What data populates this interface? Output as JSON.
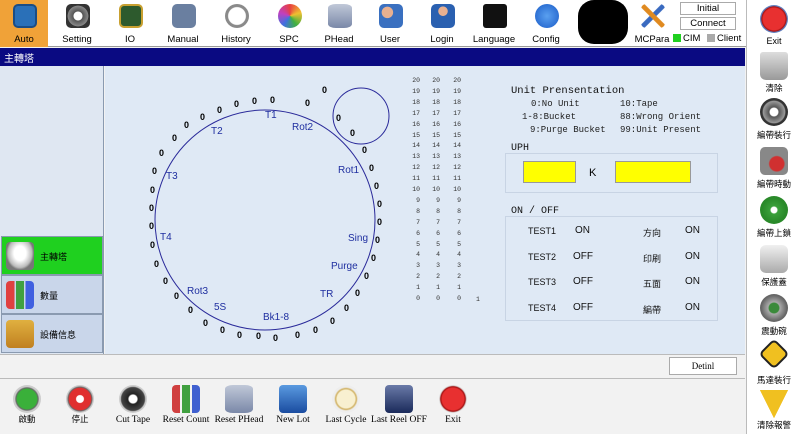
{
  "toolbar": {
    "items": [
      {
        "label": "Auto",
        "icon": "monitor-icon"
      },
      {
        "label": "Setting",
        "icon": "gear-icon"
      },
      {
        "label": "IO",
        "icon": "circuit-board-icon"
      },
      {
        "label": "Manual",
        "icon": "hand-tool-icon"
      },
      {
        "label": "History",
        "icon": "clock-icon"
      },
      {
        "label": "SPC",
        "icon": "cycle-icon"
      },
      {
        "label": "PHead",
        "icon": "database-icon"
      },
      {
        "label": "User",
        "icon": "users-icon"
      },
      {
        "label": "Login",
        "icon": "user-login-icon"
      },
      {
        "label": "Language",
        "icon": "language-icon"
      },
      {
        "label": "Config",
        "icon": "app-store-icon"
      }
    ],
    "mcpara_label": "MCPara",
    "initial_label": "Initial",
    "connect_label": "Connect",
    "cim_label": "CIM",
    "client_label": "Client",
    "exit_label": "Exit"
  },
  "title": "主轉塔",
  "left_menu": [
    {
      "label": "主轉塔",
      "icon": "turret-icon",
      "active": true
    },
    {
      "label": "數量",
      "icon": "bar-chart-icon",
      "active": false
    },
    {
      "label": "設備信息",
      "icon": "equipment-info-icon",
      "active": false
    }
  ],
  "turret": {
    "zero": "0",
    "stations": [
      "T1",
      "Rot2",
      "Rot1",
      "Sing",
      "Purge",
      "TR",
      "Bk1-8",
      "5S",
      "Rot3",
      "T4",
      "T3",
      "T2"
    ]
  },
  "columns": {
    "col1": [
      "20",
      "19",
      "18",
      "17",
      "16",
      "15",
      "14",
      "13",
      "12",
      "11",
      "10",
      "9",
      "8",
      "7",
      "6",
      "5",
      "4",
      "3",
      "2",
      "1",
      "0"
    ],
    "col2": [
      "20",
      "19",
      "18",
      "17",
      "16",
      "15",
      "14",
      "13",
      "12",
      "11",
      "10",
      "9",
      "8",
      "7",
      "6",
      "5",
      "4",
      "3",
      "2",
      "1",
      "0"
    ],
    "col3": [
      "20",
      "19",
      "18",
      "17",
      "16",
      "15",
      "14",
      "13",
      "12",
      "11",
      "10",
      "9",
      "8",
      "7",
      "6",
      "5",
      "4",
      "3",
      "2",
      "1",
      "0"
    ],
    "extra": "1"
  },
  "unit_presentation": {
    "title": "Unit Prensentation",
    "left": [
      "0:No Unit",
      "1-8:Bucket",
      "9:Purge Bucket"
    ],
    "right": [
      "10:Tape",
      "88:Wrong Orient",
      "99:Unit Present"
    ]
  },
  "uph": {
    "title": "UPH",
    "unit": "K"
  },
  "onoff": {
    "title": "ON / OFF",
    "rows": [
      {
        "name": "TEST1",
        "value": "ON",
        "name2": "方向",
        "value2": "ON"
      },
      {
        "name": "TEST2",
        "value": "OFF",
        "name2": "印刷",
        "value2": "ON"
      },
      {
        "name": "TEST3",
        "value": "OFF",
        "name2": "五面",
        "value2": "ON"
      },
      {
        "name": "TEST4",
        "value": "OFF",
        "name2": "編帶",
        "value2": "ON"
      }
    ]
  },
  "right_menu": [
    {
      "label": "清除",
      "icon": "trash-icon"
    },
    {
      "label": "編帶裝行",
      "icon": "tape-reel-icon"
    },
    {
      "label": "編帶時動",
      "icon": "tape-gear-icon"
    },
    {
      "label": "編帶上鎖",
      "icon": "tape-lock-icon"
    },
    {
      "label": "保護蓋",
      "icon": "cover-icon"
    },
    {
      "label": "震動碗",
      "icon": "vibration-bowl-icon"
    },
    {
      "label": "馬達裝行",
      "icon": "motor-warning-icon"
    },
    {
      "label": "清除報警",
      "icon": "clear-alarm-icon"
    }
  ],
  "detail_label": "Detinl",
  "bottom_menu": [
    {
      "label": "啟動",
      "icon": "play-icon"
    },
    {
      "label": "停止",
      "icon": "stop-icon"
    },
    {
      "label": "Cut Tape",
      "icon": "scissors-icon"
    },
    {
      "label": "Reset Count",
      "icon": "reset-count-icon"
    },
    {
      "label": "Reset PHead",
      "icon": "reset-phead-icon"
    },
    {
      "label": "New Lot",
      "icon": "new-lot-icon"
    },
    {
      "label": "Last Cycle",
      "icon": "last-cycle-icon"
    },
    {
      "label": "Last Reel OFF",
      "icon": "last-reel-icon"
    },
    {
      "label": "Exit",
      "icon": "exit-icon"
    }
  ]
}
